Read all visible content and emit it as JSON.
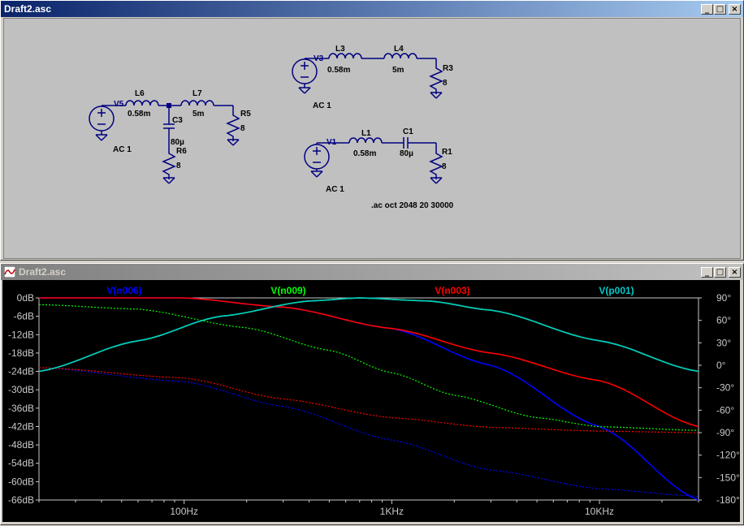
{
  "schematic_window": {
    "title": "Draft2.asc"
  },
  "plot_window": {
    "title": "Draft2.asc"
  },
  "window_buttons": {
    "minimize": "_",
    "restore": "□",
    "close": "×"
  },
  "colors": {
    "wire": "#000080",
    "plot_bg": "#000000",
    "axis": "#c8c8c8",
    "n006": "#0000ff",
    "n009": "#00ff00",
    "n003": "#ff0000",
    "p001": "#00c8c8"
  },
  "circuit": {
    "directive": ".ac oct 2048 20 30000",
    "c5": {
      "source": "V5",
      "ac": "AC 1",
      "l6": "L6",
      "l6_val": "0.58m",
      "l7": "L7",
      "l7_val": "5m",
      "c3": "C3",
      "c3_val": "80µ",
      "r6": "R6",
      "r6_val": "8",
      "r5": "R5",
      "r5_val": "8"
    },
    "c3": {
      "source": "V3",
      "ac": "AC 1",
      "l3": "L3",
      "l3_val": "0.58m",
      "l4": "L4",
      "l4_val": "5m",
      "r3": "R3",
      "r3_val": "8"
    },
    "c1": {
      "source": "V1",
      "ac": "AC 1",
      "l1": "L1",
      "l1_val": "0.58m",
      "c1": "C1",
      "c1_val": "80µ",
      "r1": "R1",
      "r1_val": "8"
    }
  },
  "chart_data": {
    "type": "line",
    "xscale": "log",
    "xlim": [
      20,
      30000
    ],
    "xticks": [
      {
        "v": 100,
        "label": "100Hz"
      },
      {
        "v": 1000,
        "label": "1KHz"
      },
      {
        "v": 10000,
        "label": "10KHz"
      }
    ],
    "ylim": [
      -66,
      0
    ],
    "yticks": [
      "0dB",
      "-6dB",
      "-12dB",
      "-18dB",
      "-24dB",
      "-30dB",
      "-36dB",
      "-42dB",
      "-48dB",
      "-54dB",
      "-60dB",
      "-66dB"
    ],
    "y2lim": [
      -180,
      90
    ],
    "y2ticks": [
      "90°",
      "60°",
      "30°",
      "0°",
      "-30°",
      "-60°",
      "-90°",
      "-120°",
      "-150°",
      "-180°"
    ],
    "grid": false,
    "series": [
      {
        "name": "V(n006)",
        "color": "#0000ff",
        "magnitude": [
          [
            20,
            0
          ],
          [
            100,
            0
          ],
          [
            300,
            -3
          ],
          [
            1000,
            -10
          ],
          [
            3000,
            -22
          ],
          [
            10000,
            -42
          ],
          [
            30000,
            -66
          ]
        ],
        "phase": [
          [
            20,
            -3
          ],
          [
            100,
            -22
          ],
          [
            300,
            -55
          ],
          [
            1000,
            -100
          ],
          [
            3000,
            -140
          ],
          [
            10000,
            -165
          ],
          [
            30000,
            -175
          ]
        ]
      },
      {
        "name": "V(n009)",
        "color": "#00ff00",
        "magnitude": [
          [
            20,
            -24
          ],
          [
            60,
            -14
          ],
          [
            150,
            -6
          ],
          [
            400,
            -1
          ],
          [
            700,
            0
          ],
          [
            1500,
            -1
          ],
          [
            3000,
            -4
          ],
          [
            10000,
            -14
          ],
          [
            30000,
            -24
          ]
        ],
        "phase": [
          [
            20,
            81
          ],
          [
            60,
            75
          ],
          [
            200,
            50
          ],
          [
            500,
            20
          ],
          [
            1000,
            -10
          ],
          [
            2000,
            -40
          ],
          [
            5000,
            -70
          ],
          [
            10000,
            -82
          ],
          [
            30000,
            -87
          ]
        ]
      },
      {
        "name": "V(n003)",
        "color": "#ff0000",
        "magnitude": [
          [
            20,
            0
          ],
          [
            100,
            0
          ],
          [
            300,
            -3
          ],
          [
            1000,
            -10
          ],
          [
            3000,
            -18
          ],
          [
            10000,
            -27
          ],
          [
            30000,
            -42
          ]
        ],
        "phase": [
          [
            20,
            -3
          ],
          [
            100,
            -17
          ],
          [
            300,
            -45
          ],
          [
            1000,
            -70
          ],
          [
            3000,
            -83
          ],
          [
            10000,
            -88
          ],
          [
            30000,
            -90
          ]
        ]
      },
      {
        "name": "V(p001)",
        "color": "#00c8c8",
        "magnitude": [
          [
            20,
            -24
          ],
          [
            60,
            -14
          ],
          [
            150,
            -6
          ],
          [
            400,
            -1
          ],
          [
            700,
            0
          ],
          [
            1500,
            -1
          ],
          [
            3000,
            -4
          ],
          [
            10000,
            -14
          ],
          [
            30000,
            -24
          ]
        ],
        "phase": []
      }
    ]
  }
}
